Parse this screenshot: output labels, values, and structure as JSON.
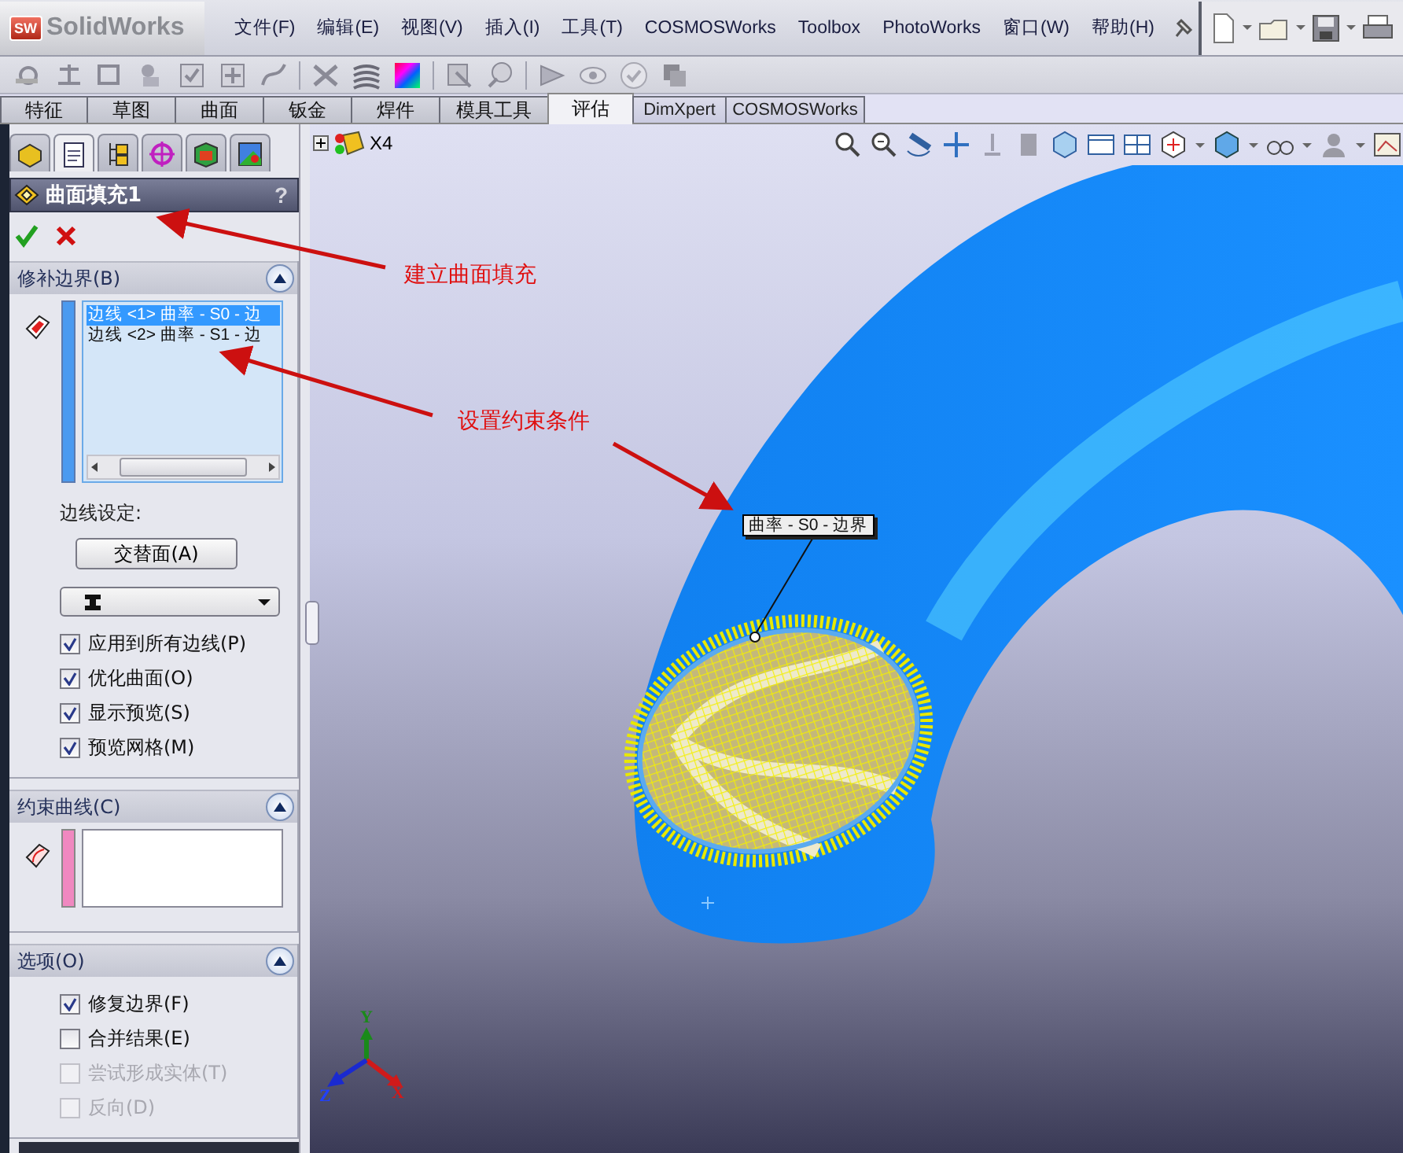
{
  "app_title": {
    "badge": "SW",
    "logo": "SolidWorks"
  },
  "menu": [
    {
      "label": "文件(F)"
    },
    {
      "label": "编辑(E)"
    },
    {
      "label": "视图(V)"
    },
    {
      "label": "插入(I)"
    },
    {
      "label": "工具(T)"
    },
    {
      "label": "COSMOSWorks"
    },
    {
      "label": "Toolbox"
    },
    {
      "label": "PhotoWorks"
    },
    {
      "label": "窗口(W)"
    },
    {
      "label": "帮助(H)"
    }
  ],
  "command_tabs": [
    {
      "label": "特征",
      "selected": false
    },
    {
      "label": "草图",
      "selected": false
    },
    {
      "label": "曲面",
      "selected": false
    },
    {
      "label": "钣金",
      "selected": false
    },
    {
      "label": "焊件",
      "selected": false
    },
    {
      "label": "模具工具",
      "selected": false
    },
    {
      "label": "评估",
      "selected": true
    },
    {
      "label": "DimXpert",
      "selected": false
    },
    {
      "label": "COSMOSWorks",
      "selected": false
    }
  ],
  "manager_tabs": [
    {
      "selected": false
    },
    {
      "selected": true
    },
    {
      "selected": false
    },
    {
      "selected": false
    },
    {
      "selected": false
    },
    {
      "selected": false
    }
  ],
  "property_manager": {
    "title": "曲面填充1",
    "help": "?",
    "patch_boundary": {
      "title": "修补边界(B)",
      "expanded": true,
      "edges": [
        {
          "label": "边线 <1> 曲率 - S0 - 边",
          "selected": true
        },
        {
          "label": "边线 <2> 曲率 - S1 - 边",
          "selected": false
        }
      ],
      "edge_settings_label": "边线设定:",
      "alternate_face_button": "交替面(A)",
      "options": [
        {
          "label": "应用到所有边线(P)",
          "checked": true,
          "disabled": false
        },
        {
          "label": "优化曲面(O)",
          "checked": true,
          "disabled": false
        },
        {
          "label": "显示预览(S)",
          "checked": true,
          "disabled": false
        },
        {
          "label": "预览网格(M)",
          "checked": true,
          "disabled": false
        }
      ]
    },
    "constraint_curves": {
      "title": "约束曲线(C)",
      "expanded": true
    },
    "options": {
      "title": "选项(O)",
      "expanded": true,
      "checkboxes": [
        {
          "label": "修复边界(F)",
          "checked": true,
          "disabled": false
        },
        {
          "label": "合并结果(E)",
          "checked": false,
          "disabled": false
        },
        {
          "label": "尝试形成实体(T)",
          "checked": false,
          "disabled": true
        },
        {
          "label": "反向(D)",
          "checked": false,
          "disabled": true
        }
      ]
    }
  },
  "viewport": {
    "tree_label": "X4",
    "callout": "曲率 - S0 - 边界",
    "triad": {
      "x": "X",
      "y": "Y",
      "z": "Z"
    }
  },
  "annotations": [
    {
      "text": "建立曲面填充"
    },
    {
      "text": "设置约束条件"
    }
  ]
}
